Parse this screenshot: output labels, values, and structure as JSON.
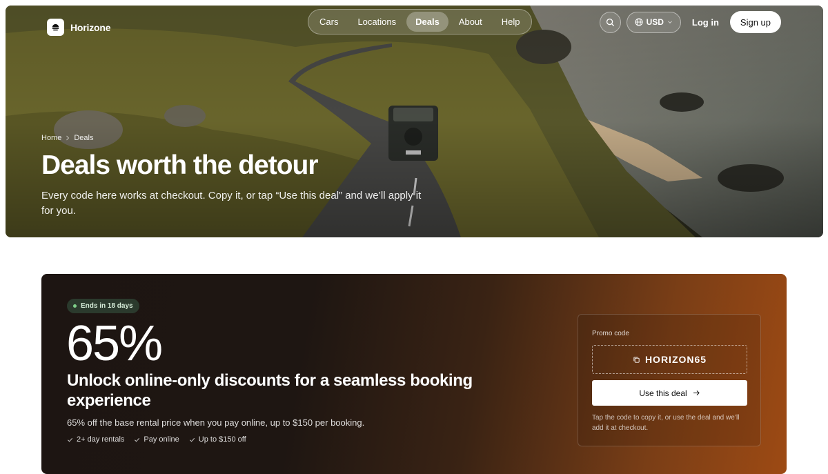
{
  "brand": {
    "name": "Horizone"
  },
  "nav": {
    "tabs": [
      {
        "label": "Cars"
      },
      {
        "label": "Locations"
      },
      {
        "label": "Deals",
        "active": true
      },
      {
        "label": "About"
      },
      {
        "label": "Help"
      }
    ]
  },
  "header": {
    "currency": "USD",
    "login": "Log in",
    "signup": "Sign up"
  },
  "breadcrumb": {
    "items": [
      "Home",
      "Deals"
    ]
  },
  "hero": {
    "title": "Deals worth the detour",
    "subtitle": "Every code here works at checkout. Copy it, or tap “Use this deal” and we’ll apply it for you."
  },
  "deal": {
    "badge": "Ends in 18 days",
    "percent": "65%",
    "title": "Unlock online-only discounts for a seamless booking experience",
    "description": "65% off the base rental price when you pay online, up to $150 per booking.",
    "features": [
      "2+ day rentals",
      "Pay online",
      "Up to $150 off"
    ],
    "promo": {
      "label": "Promo code",
      "code": "HORIZON65",
      "button": "Use this deal",
      "help": "Tap the code to copy it, or use the deal and we’ll add it at checkout."
    }
  },
  "colors": {
    "deal_gradient_end": "#9d4a14",
    "badge_dot": "#7fd08a"
  }
}
